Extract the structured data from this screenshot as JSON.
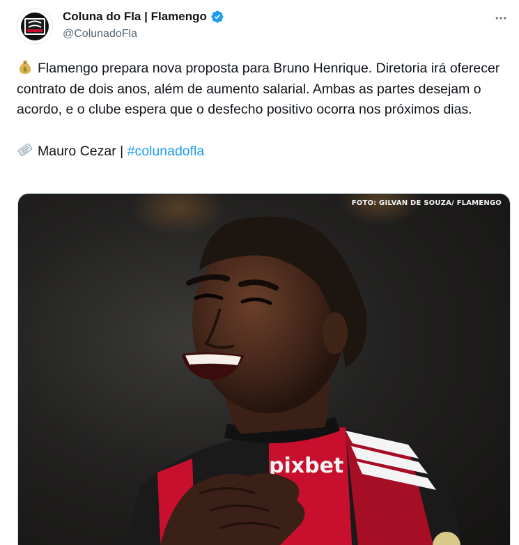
{
  "author": {
    "display_name": "Coluna do Fla | Flamengo",
    "handle": "@ColunadoFla",
    "verified": true,
    "avatar_icon": "coluna-do-fla-logo"
  },
  "tweet": {
    "line1_emoji": "money-bag-icon",
    "text": "Flamengo prepara nova proposta para Bruno Henrique. Diretoria irá oferecer contrato de dois anos, além de aumento salarial. Ambas as partes desejam o acordo, e o clube espera que o desfecho positivo ocorra nos próximos dias.",
    "source_emoji": "newspaper-icon",
    "source_name": "Mauro Cezar",
    "separator": "|",
    "hashtag": "#colunadofla"
  },
  "media": {
    "photo_credit": "FOTO: GILVAN DE SOUZA/ FLAMENGO",
    "sponsor_text": "pixbet",
    "description_icon": "player-photo"
  },
  "colors": {
    "link": "#1d9bf0",
    "verified": "#1d9bf0",
    "secondary_text": "#536471",
    "jersey_red": "#c8102e"
  }
}
